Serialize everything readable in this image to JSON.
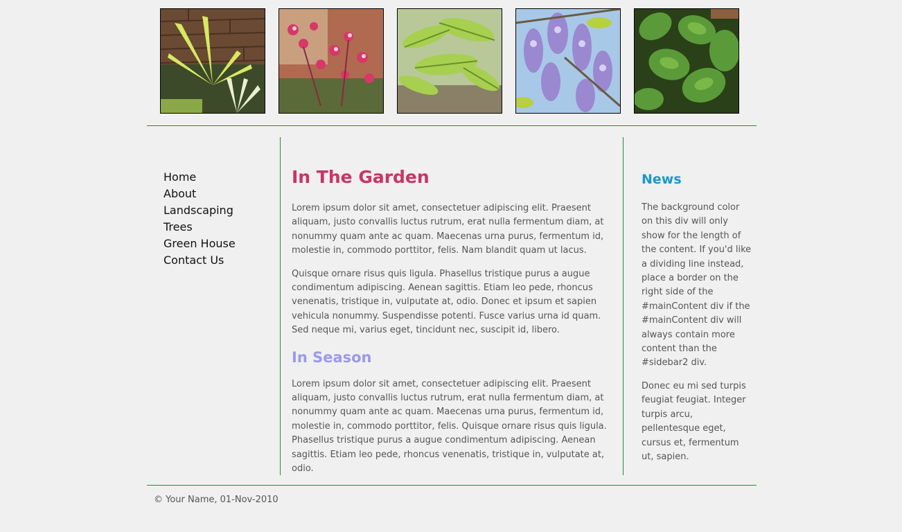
{
  "header": {
    "images": [
      {
        "name": "plant-thumbnail-1"
      },
      {
        "name": "plant-thumbnail-2"
      },
      {
        "name": "plant-thumbnail-3"
      },
      {
        "name": "plant-thumbnail-4"
      },
      {
        "name": "plant-thumbnail-5"
      }
    ]
  },
  "nav": {
    "items": [
      {
        "label": "Home"
      },
      {
        "label": "About"
      },
      {
        "label": "Landscaping"
      },
      {
        "label": "Trees"
      },
      {
        "label": "Green House"
      },
      {
        "label": "Contact Us"
      }
    ]
  },
  "main": {
    "title": "In The Garden",
    "paragraph1": "Lorem ipsum dolor sit amet, consectetuer adipiscing elit. Praesent aliquam, justo convallis luctus rutrum, erat nulla fermentum diam, at nonummy quam ante ac quam. Maecenas urna purus, fermentum id, molestie in, commodo porttitor, felis. Nam blandit quam ut lacus.",
    "paragraph2": "Quisque ornare risus quis ligula. Phasellus tristique purus a augue condimentum adipiscing. Aenean sagittis. Etiam leo pede, rhoncus venenatis, tristique in, vulputate at, odio. Donec et ipsum et sapien vehicula nonummy. Suspendisse potenti. Fusce varius urna id quam. Sed neque mi, varius eget, tincidunt nec, suscipit id, libero.",
    "subtitle": "In Season",
    "paragraph3": "Lorem ipsum dolor sit amet, consectetuer adipiscing elit. Praesent aliquam, justo convallis luctus rutrum, erat nulla fermentum diam, at nonummy quam ante ac quam. Maecenas urna purus, fermentum id, molestie in, commodo porttitor, felis. Quisque ornare risus quis ligula. Phasellus tristique purus a augue condimentum adipiscing. Aenean sagittis. Etiam leo pede, rhoncus venenatis, tristique in, vulputate at, odio."
  },
  "news": {
    "title": "News",
    "paragraph1": "The background color on this div will only show for the length of the content. If you'd like a dividing line instead, place a border on the right side of the #mainContent div if the #mainContent div will always contain more content than the #sidebar2 div.",
    "paragraph2": "Donec eu mi sed turpis feugiat feugiat. Integer turpis arcu, pellentesque eget, cursus et, fermentum ut, sapien."
  },
  "footer": {
    "text": "© Your Name, 01-Nov-2010"
  },
  "colors": {
    "background": "#f0f0f0",
    "rule": "#1f8a3c",
    "heading_main": "#cc3366",
    "heading_season": "#9999ee",
    "heading_news": "#1a9acc",
    "body_text": "#555555"
  }
}
